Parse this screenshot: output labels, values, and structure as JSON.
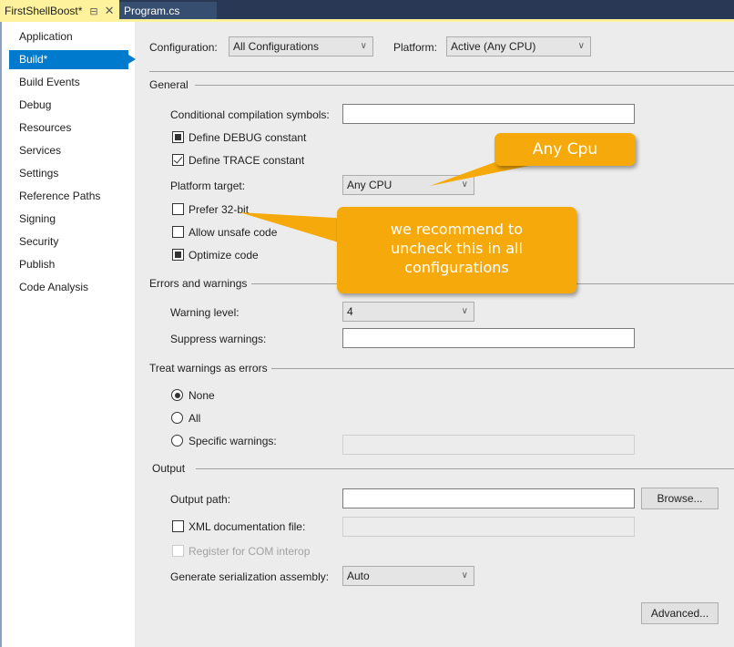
{
  "tabs": [
    {
      "label": "FirstShellBoost*",
      "active": true,
      "pin_icon": "pin-icon",
      "close_icon": "close-icon"
    },
    {
      "label": "Program.cs",
      "active": false
    }
  ],
  "sidebar": {
    "items": [
      {
        "label": "Application"
      },
      {
        "label": "Build*",
        "selected": true
      },
      {
        "label": "Build Events"
      },
      {
        "label": "Debug"
      },
      {
        "label": "Resources"
      },
      {
        "label": "Services"
      },
      {
        "label": "Settings"
      },
      {
        "label": "Reference Paths"
      },
      {
        "label": "Signing"
      },
      {
        "label": "Security"
      },
      {
        "label": "Publish"
      },
      {
        "label": "Code Analysis"
      }
    ]
  },
  "header": {
    "configuration_label": "Configuration:",
    "configuration_value": "All Configurations",
    "platform_label": "Platform:",
    "platform_value": "Active (Any CPU)"
  },
  "general": {
    "title": "General",
    "conditional_symbols_label": "Conditional compilation symbols:",
    "conditional_symbols_value": "",
    "define_debug_label": "Define DEBUG constant",
    "define_debug_state": "indeterminate",
    "define_trace_label": "Define TRACE constant",
    "define_trace_state": "checked",
    "platform_target_label": "Platform target:",
    "platform_target_value": "Any CPU",
    "prefer32_label": "Prefer 32-bit",
    "prefer32_state": "unchecked",
    "unsafe_label": "Allow unsafe code",
    "unsafe_state": "unchecked",
    "optimize_label": "Optimize code",
    "optimize_state": "indeterminate"
  },
  "errors": {
    "title": "Errors and warnings",
    "warning_level_label": "Warning level:",
    "warning_level_value": "4",
    "suppress_label": "Suppress warnings:",
    "suppress_value": ""
  },
  "treat_warnings": {
    "title": "Treat warnings as errors",
    "options": [
      {
        "label": "None",
        "selected": true
      },
      {
        "label": "All",
        "selected": false
      },
      {
        "label": "Specific warnings:",
        "selected": false
      }
    ],
    "specific_value": ""
  },
  "output": {
    "title": "Output",
    "output_path_label": "Output path:",
    "output_path_value": "",
    "browse_label": "Browse...",
    "xml_doc_label": "XML documentation file:",
    "xml_doc_state": "unchecked",
    "xml_doc_value": "",
    "com_interop_label": "Register for COM interop",
    "com_interop_state": "unchecked-disabled",
    "serialization_label": "Generate serialization assembly:",
    "serialization_value": "Auto",
    "advanced_label": "Advanced..."
  },
  "annotations": {
    "callout_platform": "Any Cpu",
    "callout_prefer32": "we recommend to uncheck this in all configurations",
    "color": "#f5a90a"
  },
  "colors": {
    "accent": "#007acc",
    "active_tab": "#fff29d",
    "tab_bar": "#293955",
    "content_bg": "#ececec"
  }
}
